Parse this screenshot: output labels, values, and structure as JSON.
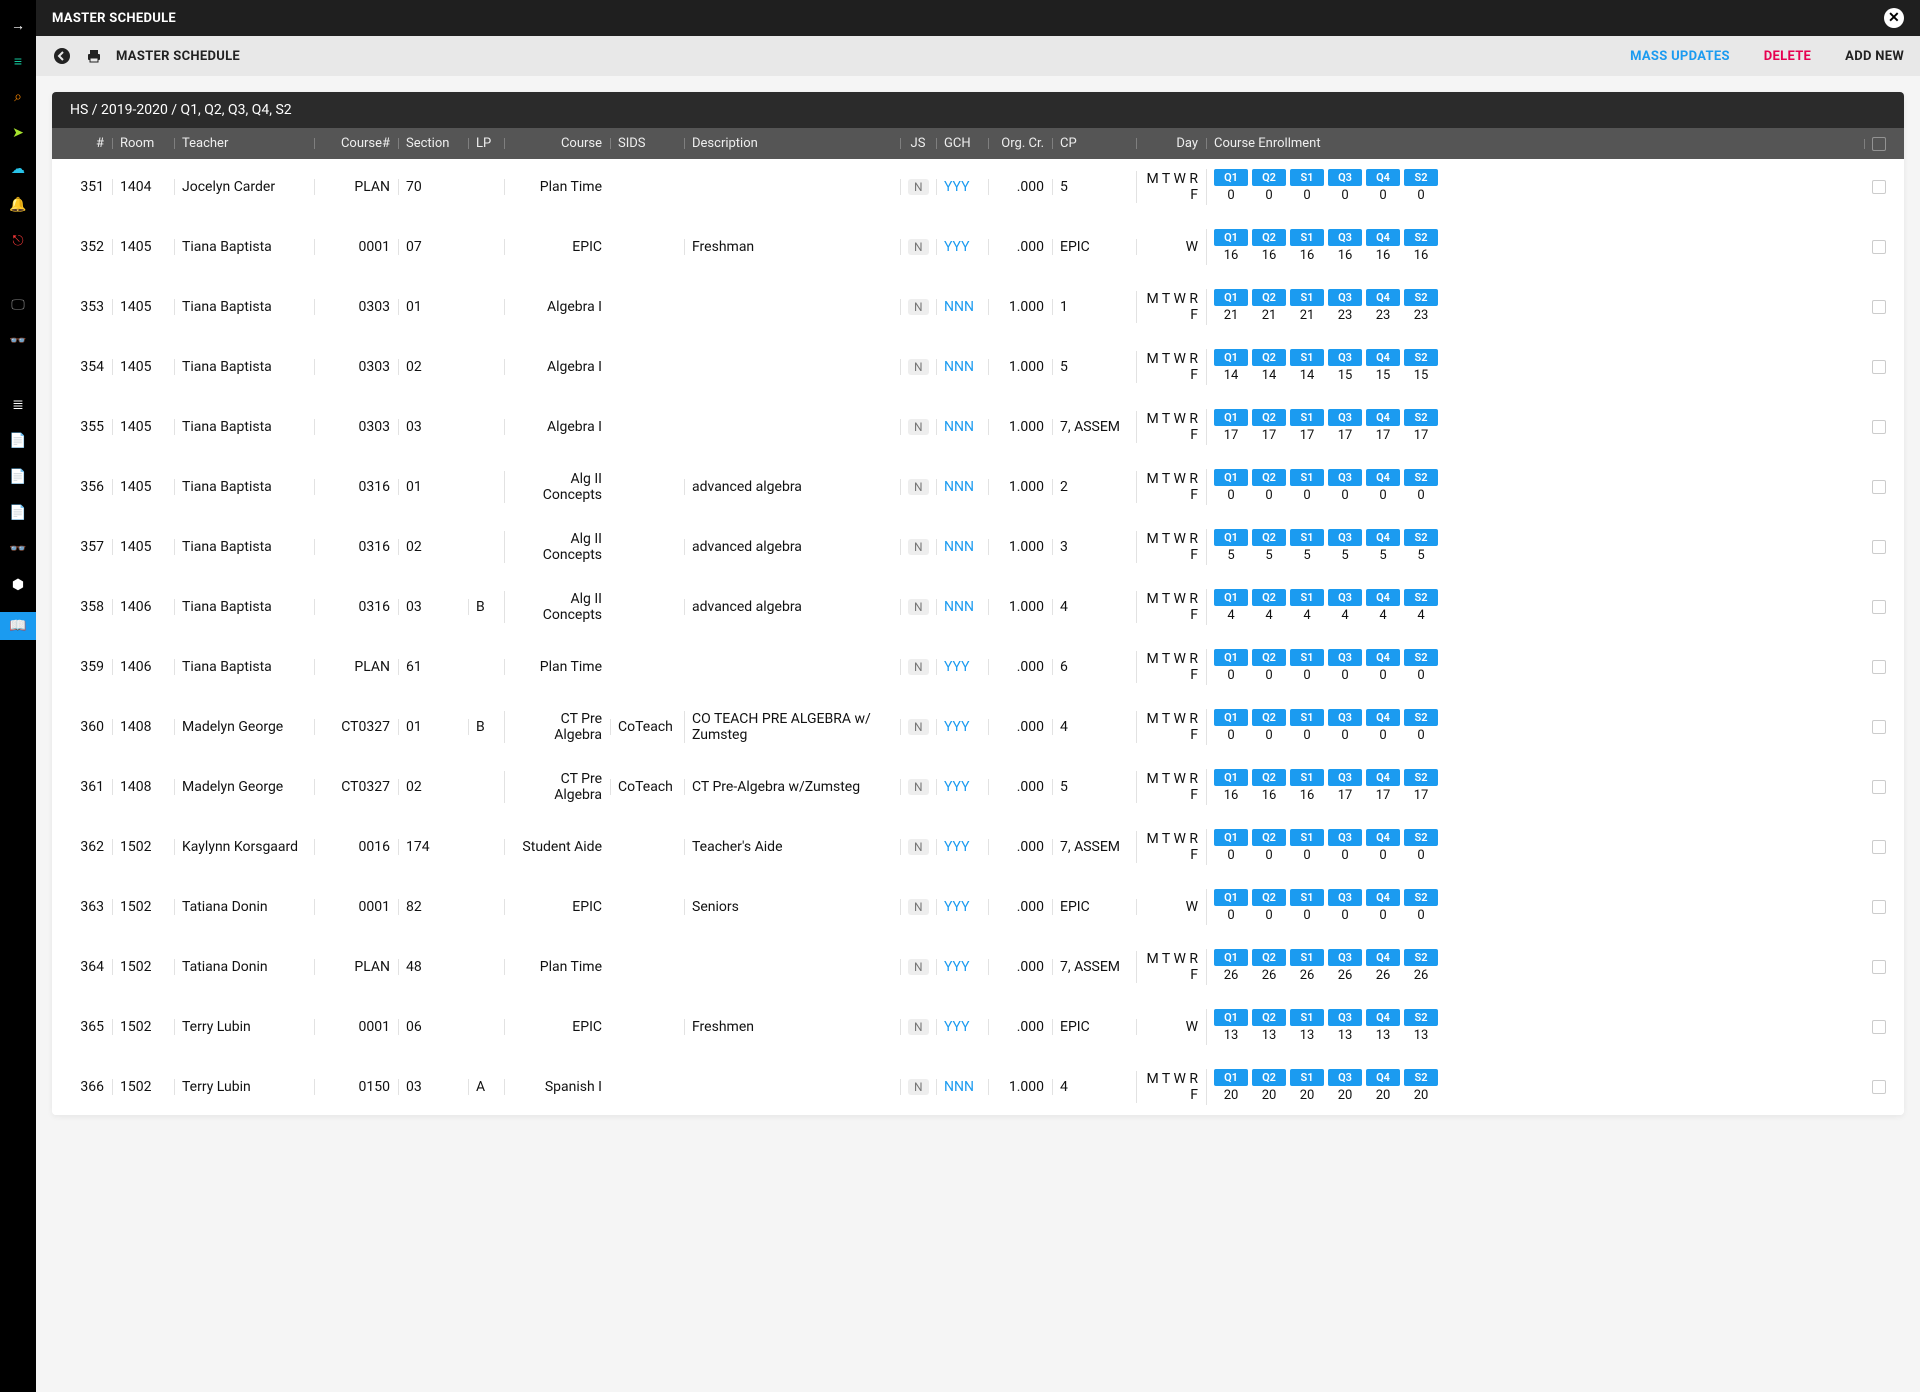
{
  "topbar": {
    "title": "MASTER SCHEDULE"
  },
  "actionbar": {
    "title": "MASTER SCHEDULE",
    "mass_updates": "MASS UPDATES",
    "delete": "DELETE",
    "add_new": "ADD NEW"
  },
  "panel": {
    "breadcrumb": "HS / 2019-2020 / Q1, Q2, Q3, Q4, S2",
    "columns": {
      "num": "#",
      "room": "Room",
      "teacher": "Teacher",
      "course_num": "Course#",
      "section": "Section",
      "lp": "LP",
      "course": "Course",
      "sids": "SIDS",
      "description": "Description",
      "js": "JS",
      "gch": "GCH",
      "org_cr": "Org. Cr.",
      "cp": "CP",
      "day": "Day",
      "enrollment": "Course Enrollment"
    },
    "enroll_labels": [
      "Q1",
      "Q2",
      "S1",
      "Q3",
      "Q4",
      "S2"
    ],
    "rows": [
      {
        "num": "351",
        "room": "1404",
        "teacher": "Jocelyn Carder",
        "coursenum": "PLAN",
        "section": "70",
        "lp": "",
        "course": "Plan Time",
        "sids": "",
        "desc": "",
        "js": "N",
        "gch": "YYY",
        "orgcr": ".000",
        "cp": "5",
        "day": "M T W R F",
        "enroll": [
          0,
          0,
          0,
          0,
          0,
          0
        ]
      },
      {
        "num": "352",
        "room": "1405",
        "teacher": "Tiana Baptista",
        "coursenum": "0001",
        "section": "07",
        "lp": "",
        "course": "EPIC",
        "sids": "",
        "desc": "Freshman",
        "js": "N",
        "gch": "YYY",
        "orgcr": ".000",
        "cp": "EPIC",
        "day": "W",
        "enroll": [
          16,
          16,
          16,
          16,
          16,
          16
        ]
      },
      {
        "num": "353",
        "room": "1405",
        "teacher": "Tiana Baptista",
        "coursenum": "0303",
        "section": "01",
        "lp": "",
        "course": "Algebra I",
        "sids": "",
        "desc": "",
        "js": "N",
        "gch": "NNN",
        "orgcr": "1.000",
        "cp": "1",
        "day": "M T W R F",
        "enroll": [
          21,
          21,
          21,
          23,
          23,
          23
        ]
      },
      {
        "num": "354",
        "room": "1405",
        "teacher": "Tiana Baptista",
        "coursenum": "0303",
        "section": "02",
        "lp": "",
        "course": "Algebra I",
        "sids": "",
        "desc": "",
        "js": "N",
        "gch": "NNN",
        "orgcr": "1.000",
        "cp": "5",
        "day": "M T W R F",
        "enroll": [
          14,
          14,
          14,
          15,
          15,
          15
        ]
      },
      {
        "num": "355",
        "room": "1405",
        "teacher": "Tiana Baptista",
        "coursenum": "0303",
        "section": "03",
        "lp": "",
        "course": "Algebra I",
        "sids": "",
        "desc": "",
        "js": "N",
        "gch": "NNN",
        "orgcr": "1.000",
        "cp": "7, ASSEM",
        "day": "M T W R F",
        "enroll": [
          17,
          17,
          17,
          17,
          17,
          17
        ]
      },
      {
        "num": "356",
        "room": "1405",
        "teacher": "Tiana Baptista",
        "coursenum": "0316",
        "section": "01",
        "lp": "",
        "course": "Alg II Concepts",
        "sids": "",
        "desc": "advanced algebra",
        "js": "N",
        "gch": "NNN",
        "orgcr": "1.000",
        "cp": "2",
        "day": "M T W R F",
        "enroll": [
          0,
          0,
          0,
          0,
          0,
          0
        ]
      },
      {
        "num": "357",
        "room": "1405",
        "teacher": "Tiana Baptista",
        "coursenum": "0316",
        "section": "02",
        "lp": "",
        "course": "Alg II Concepts",
        "sids": "",
        "desc": "advanced algebra",
        "js": "N",
        "gch": "NNN",
        "orgcr": "1.000",
        "cp": "3",
        "day": "M T W R F",
        "enroll": [
          5,
          5,
          5,
          5,
          5,
          5
        ]
      },
      {
        "num": "358",
        "room": "1406",
        "teacher": "Tiana Baptista",
        "coursenum": "0316",
        "section": "03",
        "lp": "B",
        "course": "Alg II Concepts",
        "sids": "",
        "desc": "advanced algebra",
        "js": "N",
        "gch": "NNN",
        "orgcr": "1.000",
        "cp": "4",
        "day": "M T W R F",
        "enroll": [
          4,
          4,
          4,
          4,
          4,
          4
        ]
      },
      {
        "num": "359",
        "room": "1406",
        "teacher": "Tiana Baptista",
        "coursenum": "PLAN",
        "section": "61",
        "lp": "",
        "course": "Plan Time",
        "sids": "",
        "desc": "",
        "js": "N",
        "gch": "YYY",
        "orgcr": ".000",
        "cp": "6",
        "day": "M T W R F",
        "enroll": [
          0,
          0,
          0,
          0,
          0,
          0
        ]
      },
      {
        "num": "360",
        "room": "1408",
        "teacher": "Madelyn George",
        "coursenum": "CT0327",
        "section": "01",
        "lp": "B",
        "course": "CT Pre Algebra",
        "sids": "CoTeach",
        "desc": "CO TEACH PRE ALGEBRA w/ Zumsteg",
        "js": "N",
        "gch": "YYY",
        "orgcr": ".000",
        "cp": "4",
        "day": "M T W R F",
        "enroll": [
          0,
          0,
          0,
          0,
          0,
          0
        ]
      },
      {
        "num": "361",
        "room": "1408",
        "teacher": "Madelyn George",
        "coursenum": "CT0327",
        "section": "02",
        "lp": "",
        "course": "CT Pre Algebra",
        "sids": "CoTeach",
        "desc": "CT  Pre-Algebra w/Zumsteg",
        "js": "N",
        "gch": "YYY",
        "orgcr": ".000",
        "cp": "5",
        "day": "M T W R F",
        "enroll": [
          16,
          16,
          16,
          17,
          17,
          17
        ]
      },
      {
        "num": "362",
        "room": "1502",
        "teacher": "Kaylynn Korsgaard",
        "coursenum": "0016",
        "section": "174",
        "lp": "",
        "course": "Student Aide",
        "sids": "",
        "desc": "Teacher's Aide",
        "js": "N",
        "gch": "YYY",
        "orgcr": ".000",
        "cp": "7, ASSEM",
        "day": "M T W R F",
        "enroll": [
          0,
          0,
          0,
          0,
          0,
          0
        ]
      },
      {
        "num": "363",
        "room": "1502",
        "teacher": "Tatiana Donin",
        "coursenum": "0001",
        "section": "82",
        "lp": "",
        "course": "EPIC",
        "sids": "",
        "desc": "Seniors",
        "js": "N",
        "gch": "YYY",
        "orgcr": ".000",
        "cp": "EPIC",
        "day": "W",
        "enroll": [
          0,
          0,
          0,
          0,
          0,
          0
        ]
      },
      {
        "num": "364",
        "room": "1502",
        "teacher": "Tatiana Donin",
        "coursenum": "PLAN",
        "section": "48",
        "lp": "",
        "course": "Plan Time",
        "sids": "",
        "desc": "",
        "js": "N",
        "gch": "YYY",
        "orgcr": ".000",
        "cp": "7, ASSEM",
        "day": "M T W R F",
        "enroll": [
          26,
          26,
          26,
          26,
          26,
          26
        ]
      },
      {
        "num": "365",
        "room": "1502",
        "teacher": "Terry Lubin",
        "coursenum": "0001",
        "section": "06",
        "lp": "",
        "course": "EPIC",
        "sids": "",
        "desc": "Freshmen",
        "js": "N",
        "gch": "YYY",
        "orgcr": ".000",
        "cp": "EPIC",
        "day": "W",
        "enroll": [
          13,
          13,
          13,
          13,
          13,
          13
        ]
      },
      {
        "num": "366",
        "room": "1502",
        "teacher": "Terry Lubin",
        "coursenum": "0150",
        "section": "03",
        "lp": "A",
        "course": "Spanish I",
        "sids": "",
        "desc": "",
        "js": "N",
        "gch": "NNN",
        "orgcr": "1.000",
        "cp": "4",
        "day": "M T W R F",
        "enroll": [
          20,
          20,
          20,
          20,
          20,
          20
        ]
      }
    ]
  }
}
